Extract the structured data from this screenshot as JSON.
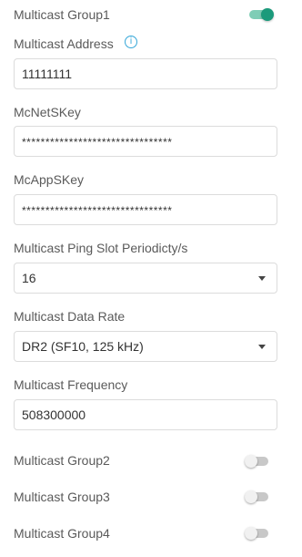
{
  "groups": {
    "g1": {
      "label": "Multicast Group1",
      "enabled": true
    },
    "g2": {
      "label": "Multicast Group2",
      "enabled": false
    },
    "g3": {
      "label": "Multicast Group3",
      "enabled": false
    },
    "g4": {
      "label": "Multicast Group4",
      "enabled": false
    }
  },
  "fields": {
    "address": {
      "label": "Multicast Address",
      "value": "11111111"
    },
    "mcnetskey": {
      "label": "McNetSKey",
      "value": "********************************"
    },
    "mcappskey": {
      "label": "McAppSKey",
      "value": "********************************"
    },
    "ping_slot": {
      "label": "Multicast Ping Slot Periodicty/s",
      "value": "16"
    },
    "data_rate": {
      "label": "Multicast Data Rate",
      "value": "DR2 (SF10, 125 kHz)"
    },
    "frequency": {
      "label": "Multicast Frequency",
      "value": "508300000"
    }
  },
  "icons": {
    "info": "info-icon",
    "dropdown": "chevron-down-icon"
  },
  "colors": {
    "toggle_on": "#1b9a7b",
    "toggle_off": "#c8c8c8",
    "info": "#35a7d8"
  }
}
